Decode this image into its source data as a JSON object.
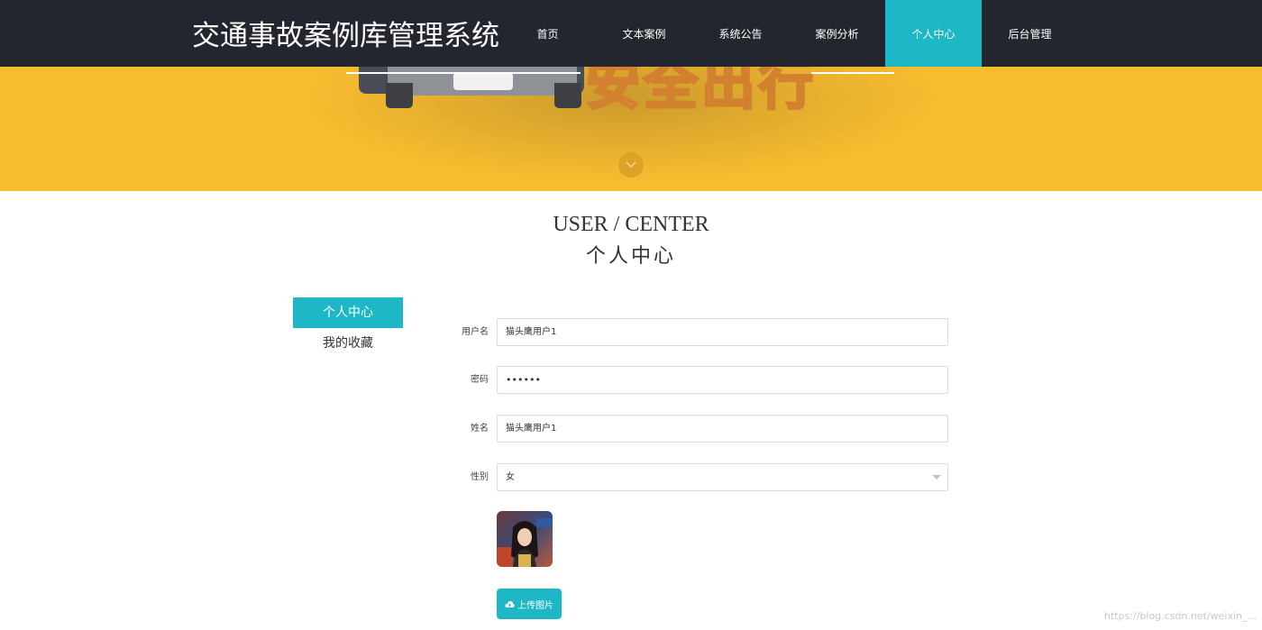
{
  "nav": {
    "brand": "交通事故案例库管理系统",
    "items": [
      {
        "label": "首页"
      },
      {
        "label": "文本案例"
      },
      {
        "label": "系统公告"
      },
      {
        "label": "案例分析"
      },
      {
        "label": "个人中心",
        "active": true
      },
      {
        "label": "后台管理"
      }
    ]
  },
  "hero": {
    "slogan": "安全出行",
    "scroll_icon": "chevron-down-icon"
  },
  "section": {
    "title_en": "USER / CENTER",
    "title_cn": "个人中心"
  },
  "sidebar": {
    "items": [
      {
        "label": "个人中心",
        "active": true
      },
      {
        "label": "我的收藏"
      }
    ]
  },
  "form": {
    "username": {
      "label": "用户名",
      "value": "猫头鹰用户1"
    },
    "password": {
      "label": "密码",
      "value": "••••••"
    },
    "name": {
      "label": "姓名",
      "value": "猫头鹰用户1"
    },
    "gender": {
      "label": "性别",
      "value": "女"
    },
    "upload_label": "上传图片",
    "upload_icon": "cloud-upload-icon"
  },
  "watermark": "https://blog.csdn.net/weixin_..."
}
